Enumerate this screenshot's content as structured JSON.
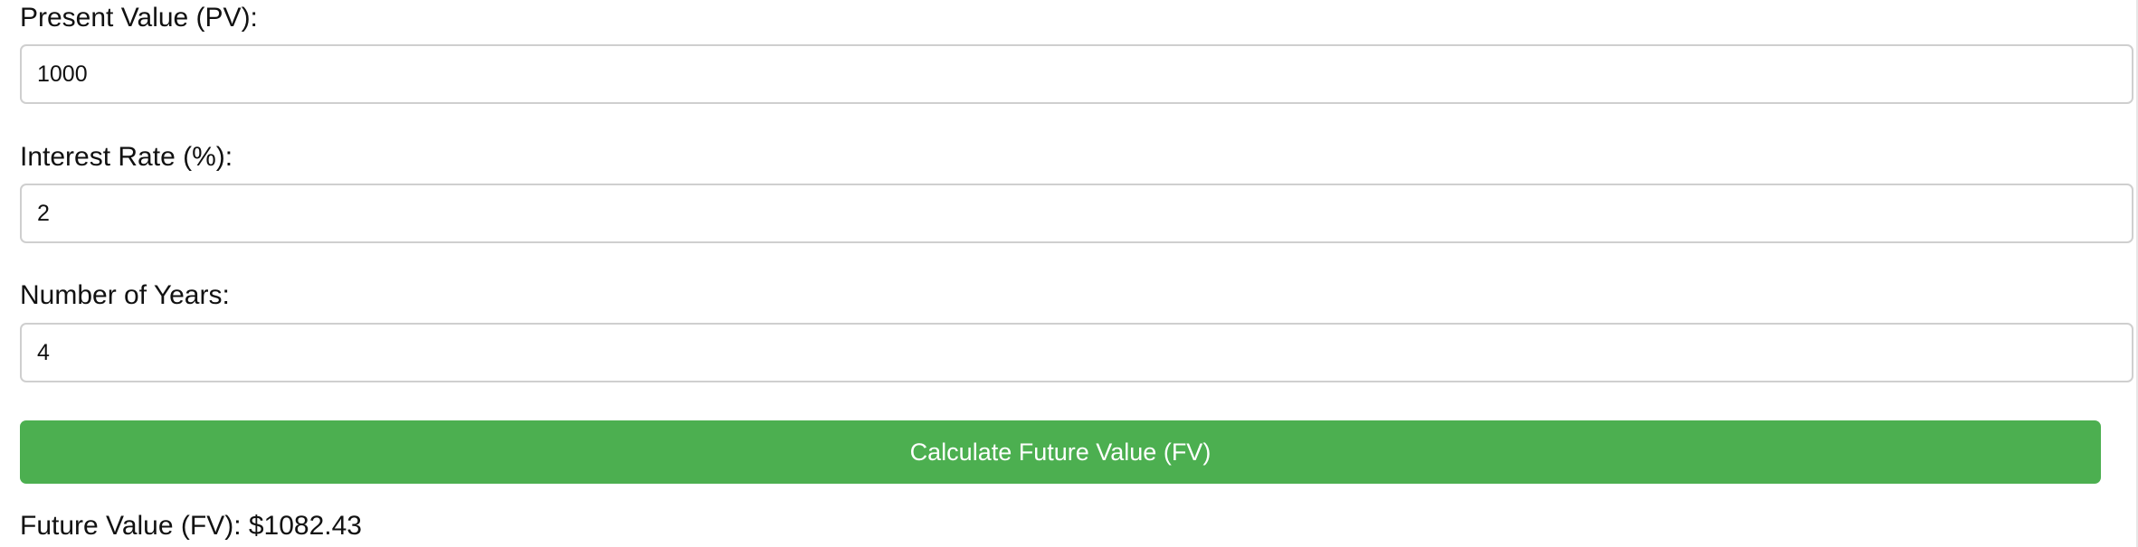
{
  "form": {
    "fields": [
      {
        "label": "Present Value (PV):",
        "value": "1000"
      },
      {
        "label": "Interest Rate (%):",
        "value": "2"
      },
      {
        "label": "Number of Years:",
        "value": "4"
      }
    ],
    "submit_label": "Calculate Future Value (FV)"
  },
  "result": {
    "text": "Future Value (FV): $1082.43"
  },
  "colors": {
    "button_background": "#4caf50",
    "button_text": "#ffffff",
    "input_border": "#cfcfcf",
    "text": "#111111"
  }
}
